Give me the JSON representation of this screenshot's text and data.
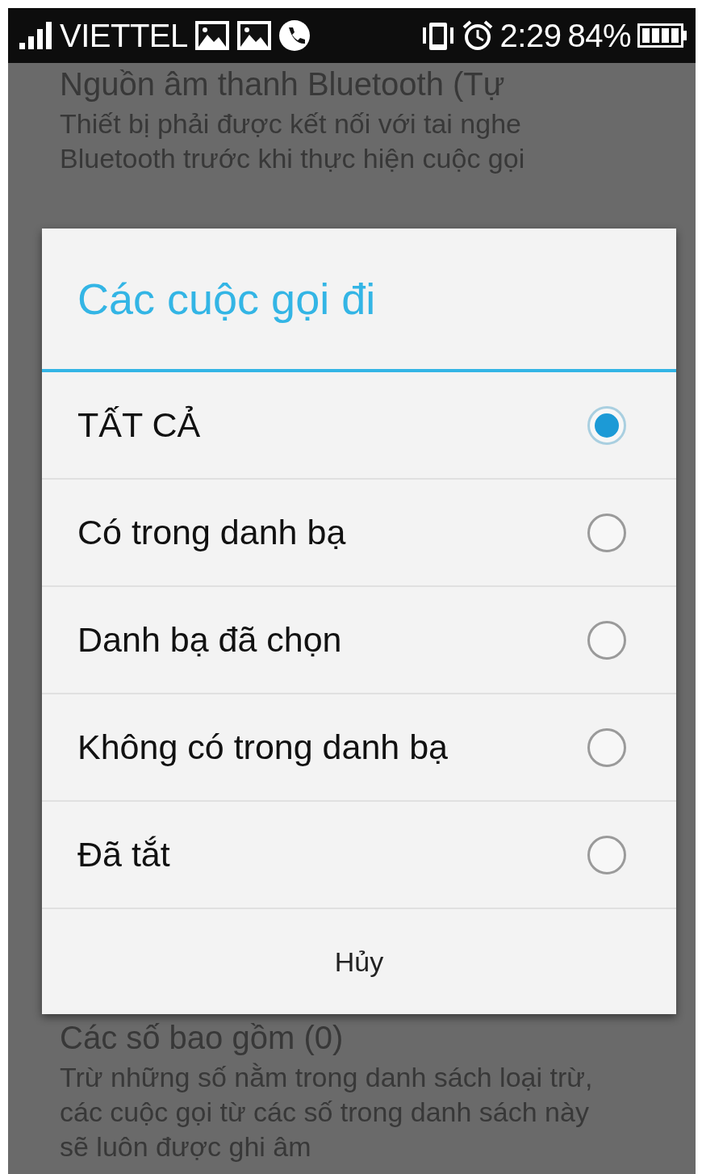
{
  "status_bar": {
    "carrier": "VIETTEL",
    "time": "2:29",
    "battery": "84%"
  },
  "background": {
    "top": {
      "title": "Nguồn âm thanh Bluetooth (Tự",
      "description": "Thiết bị phải được kết nối với tai nghe Bluetooth trước khi thực hiện cuộc gọi"
    },
    "bottom": {
      "title": "Các số bao gồm (0)",
      "description": "Trừ những số nằm trong danh sách loại trừ, các cuộc gọi từ các số trong danh sách này sẽ luôn được ghi âm"
    }
  },
  "dialog": {
    "title": "Các cuộc gọi đi",
    "options": [
      {
        "label": "TẤT CẢ",
        "selected": true
      },
      {
        "label": "Có trong danh bạ",
        "selected": false
      },
      {
        "label": "Danh bạ đã chọn",
        "selected": false
      },
      {
        "label": "Không có trong danh bạ",
        "selected": false
      },
      {
        "label": "Đã tắt",
        "selected": false
      }
    ],
    "cancel": "Hủy"
  }
}
